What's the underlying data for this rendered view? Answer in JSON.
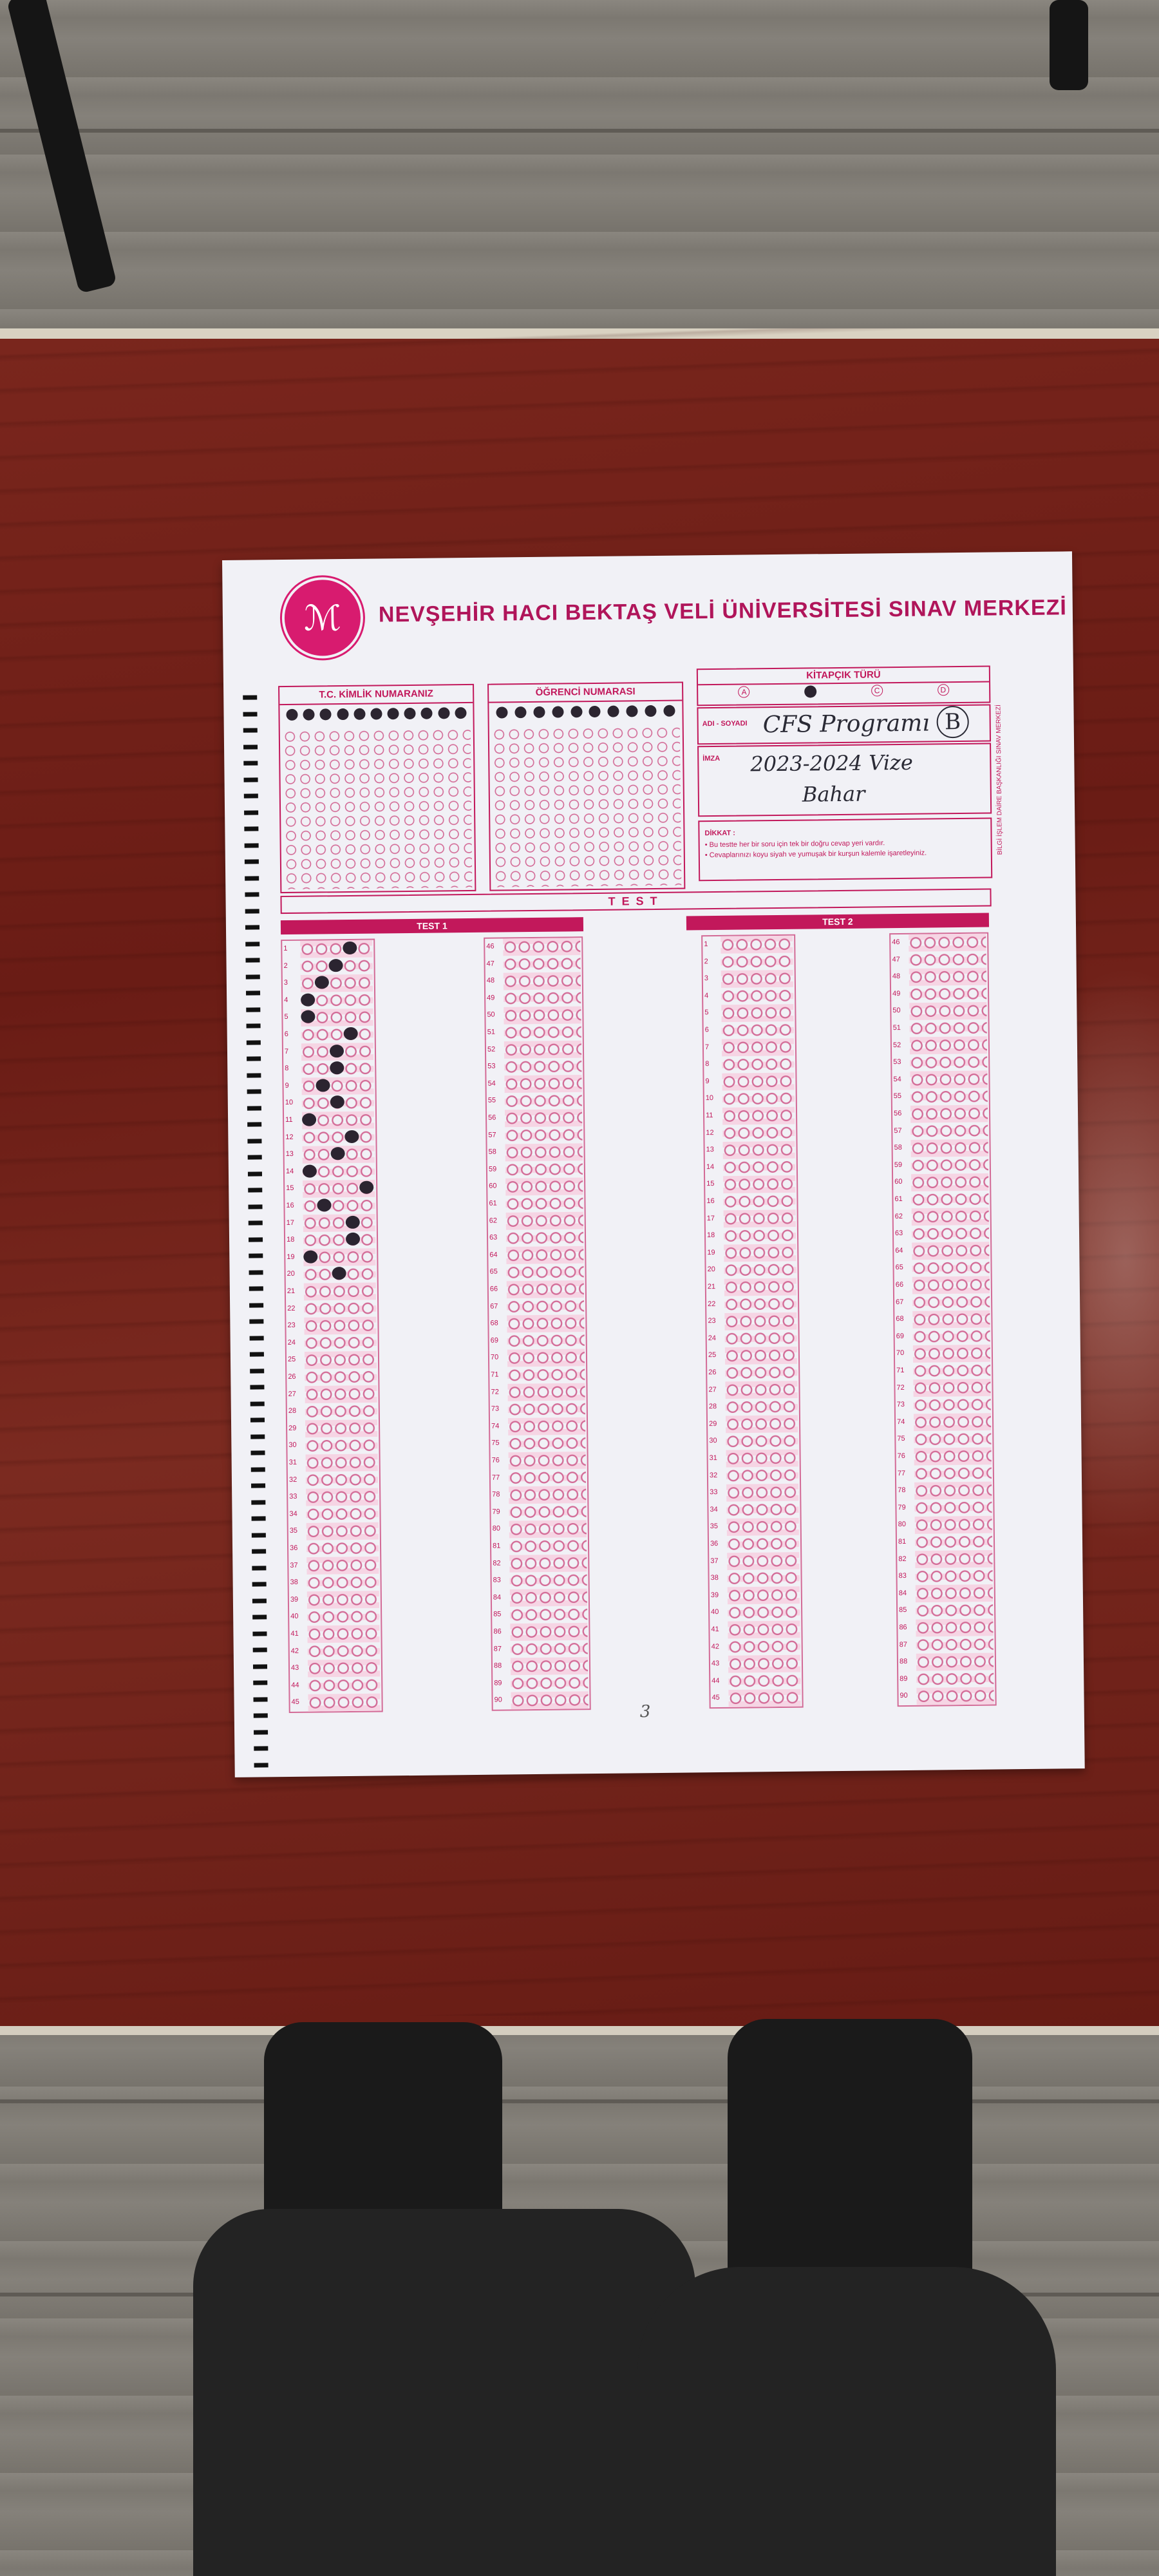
{
  "sheet": {
    "title": "NEVŞEHİR HACI BEKTAŞ VELİ ÜNİVERSİTESİ SINAV MERKEZİ",
    "id_label": "T.C. KİMLİK NUMARANIZ",
    "student_no_label": "ÖĞRENCİ NUMARASI",
    "booklet_label": "KİTAPÇIK TÜRÜ",
    "booklet_options": [
      "A",
      "B",
      "C",
      "D"
    ],
    "name_label": "ADI - SOYADI",
    "signature_label": "İMZA",
    "warning_label": "DİKKAT :",
    "warning_lines": [
      "• Bu testte her bir soru için tek bir doğru cevap yeri vardır.",
      "• Cevaplarınızı koyu siyah ve yumuşak bir kurşun kalemle işaretleyiniz."
    ],
    "side_text": "BİLGİ İŞLEM DAİRE BAŞKANLIĞI SINAV MERKEZİ",
    "test_banner": "TEST",
    "test1": "TEST 1",
    "test2": "TEST 2",
    "page_number": "3"
  },
  "handwriting": {
    "name": "CFS Programı",
    "booklet_circled": "B",
    "signature_line1": "2023-2024 Vize",
    "signature_line2": "Bahar"
  }
}
